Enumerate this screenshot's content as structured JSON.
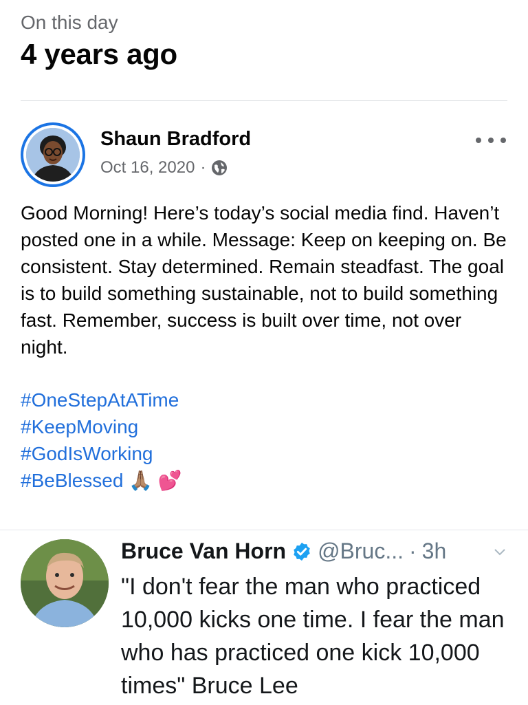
{
  "memory": {
    "kicker": "On this day",
    "headline": "4 years ago"
  },
  "post": {
    "author": "Shaun Bradford",
    "date": "Oct 16, 2020",
    "separator": "·",
    "privacy_icon": "globe-icon",
    "body": "Good Morning! Here’s today’s social media find. Haven’t posted one in a while. Message: Keep on keeping on. Be consistent. Stay determined. Remain steadfast. The goal is to build something sustainable, not to build something fast. Remember, success is built over time, not over night.",
    "hashtags": [
      "#OneStepAtATime",
      "#KeepMoving",
      "#GodIsWorking",
      "#BeBlessed"
    ],
    "trailing_emoji": "🙏🏽 💕"
  },
  "embedded_tweet": {
    "name": "Bruce Van Horn",
    "handle": "@Bruc...",
    "separator": "·",
    "time": "3h",
    "text": "\"I don't fear the man who practiced 10,000 kicks one time. I fear the man who has practiced one kick 10,000 times\" Bruce Lee"
  },
  "colors": {
    "link": "#216fdb",
    "avatar_ring": "#1b74e4",
    "verified": "#1da1f2",
    "secondary_text": "#65676b"
  }
}
